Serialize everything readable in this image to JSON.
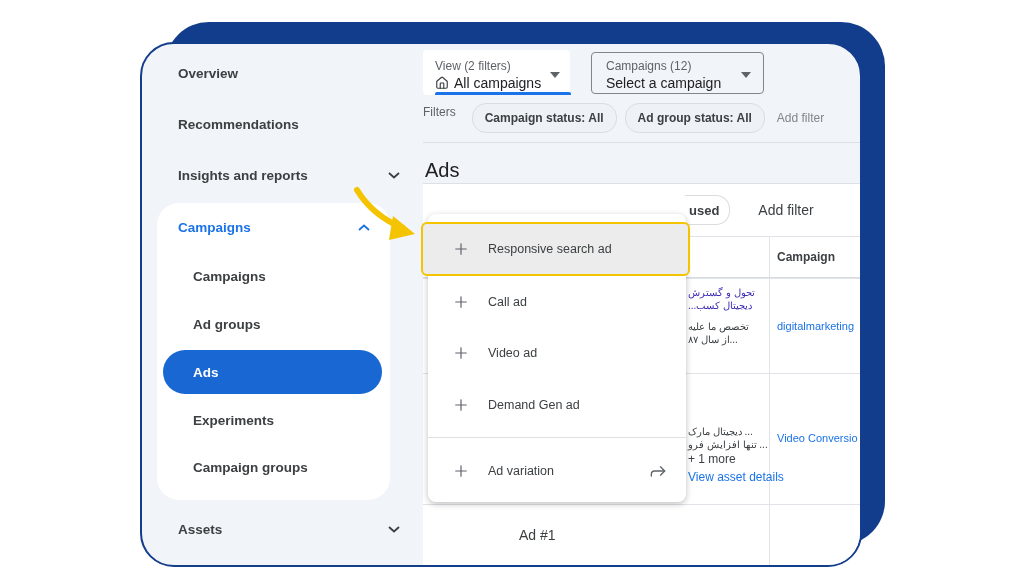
{
  "sidebar": {
    "items": [
      {
        "label": "Overview",
        "kind": "link"
      },
      {
        "label": "Recommendations",
        "kind": "link"
      },
      {
        "label": "Insights and reports",
        "kind": "group",
        "expanded": false
      },
      {
        "label": "Campaigns",
        "kind": "group",
        "expanded": true,
        "children": [
          {
            "label": "Campaigns",
            "selected": false
          },
          {
            "label": "Ad groups",
            "selected": false
          },
          {
            "label": "Ads",
            "selected": true
          },
          {
            "label": "Experiments",
            "selected": false
          },
          {
            "label": "Campaign groups",
            "selected": false
          }
        ]
      },
      {
        "label": "Assets",
        "kind": "group",
        "expanded": false
      }
    ]
  },
  "view_selector": {
    "label": "View (2 filters)",
    "value": "All campaigns"
  },
  "campaign_selector": {
    "label": "Campaigns (12)",
    "value": "Select a campaign"
  },
  "filters": {
    "label": "Filters",
    "chips": [
      "Campaign status: All",
      "Ad group status: All"
    ],
    "add": "Add filter"
  },
  "page_title": "Ads",
  "table": {
    "toolbar": {
      "chip": "used",
      "add": "Add filter"
    },
    "columns": [
      "Campaign"
    ],
    "rows": [
      {
        "kind": "search",
        "headline_lines": [
          "تحول و گسترش",
          "دیجیتال کسب..."
        ],
        "description_lines": [
          "تخصص ما علیه",
          "...از سال ۸۷"
        ],
        "campaign": "digitalmarketing"
      },
      {
        "kind": "video",
        "description_lines": [
          "... دیجیتال مارک",
          "... تنها افزایش فرو"
        ],
        "more": "+ 1 more",
        "link": "View asset details",
        "campaign": "Video Conversio"
      },
      {
        "kind": "plain",
        "title": "Ad #1"
      }
    ]
  },
  "menu": {
    "items": [
      {
        "label": "Responsive search ad",
        "kind": "add",
        "highlighted": true
      },
      {
        "label": "Call ad",
        "kind": "add",
        "highlighted": false
      },
      {
        "label": "Video ad",
        "kind": "add",
        "highlighted": false
      },
      {
        "label": "Demand Gen ad",
        "kind": "add",
        "highlighted": false
      },
      {
        "label": "Ad variation",
        "kind": "link",
        "highlighted": false
      }
    ]
  }
}
